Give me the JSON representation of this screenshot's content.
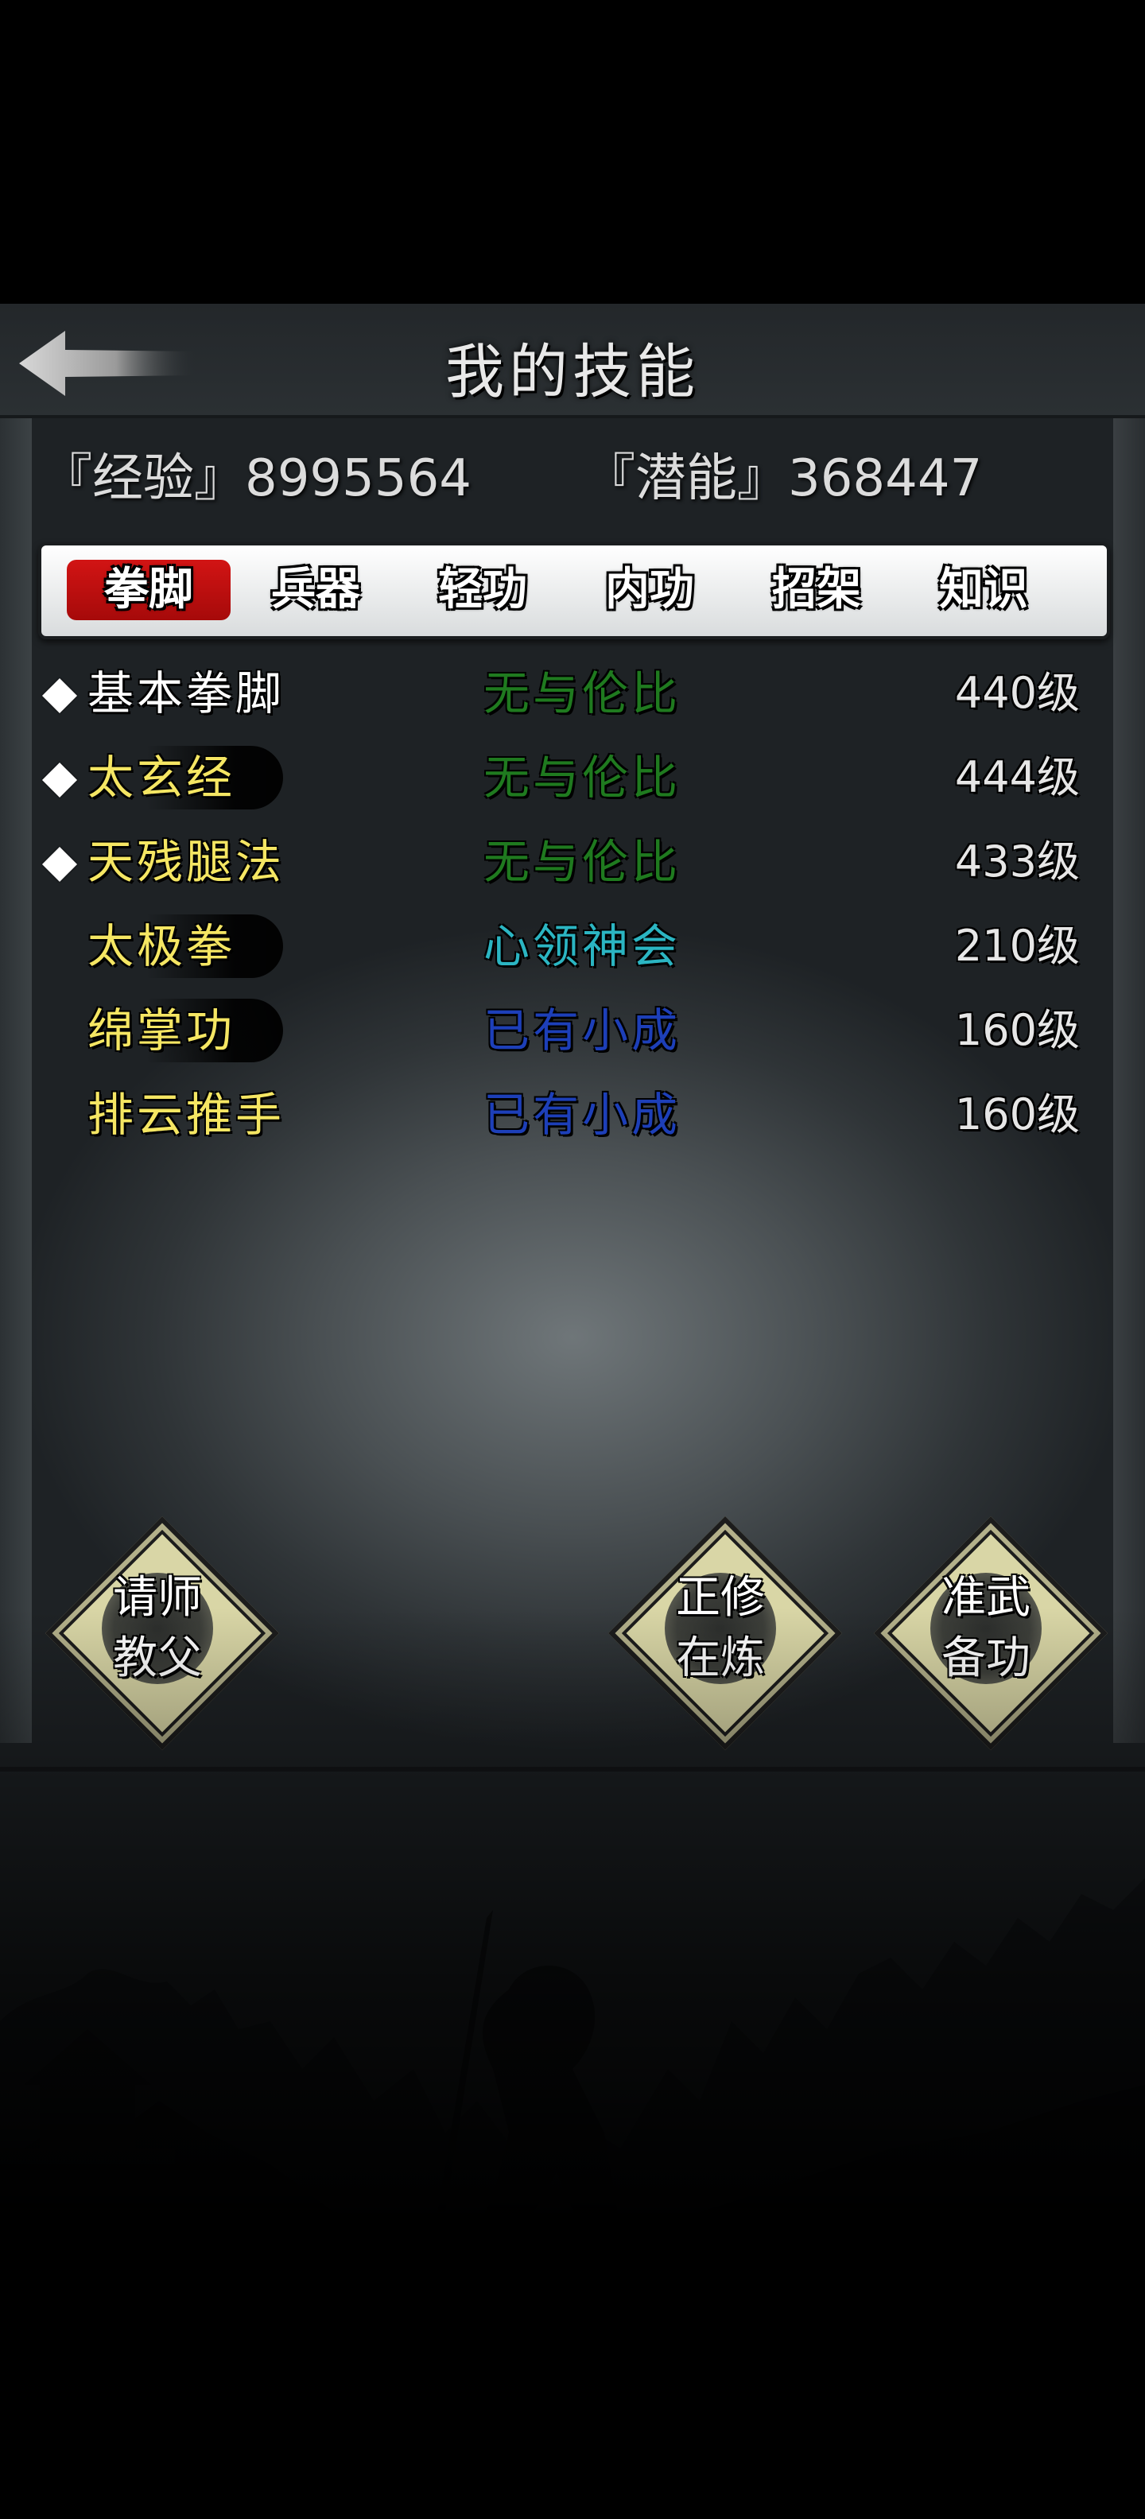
{
  "header": {
    "title": "我的技能",
    "back_icon": "back-arrow-icon"
  },
  "stats": {
    "experience": "『经验』8995564",
    "potential": "『潜能』368447"
  },
  "tabs": [
    {
      "label": "拳脚",
      "active": true
    },
    {
      "label": "兵器",
      "active": false
    },
    {
      "label": "轻功",
      "active": false
    },
    {
      "label": "内功",
      "active": false
    },
    {
      "label": "招架",
      "active": false
    },
    {
      "label": "知识",
      "active": false
    }
  ],
  "skills": [
    {
      "name": "基本拳脚",
      "rank": "无与伦比",
      "level": "440级",
      "marked": true,
      "name_color": "#ffffff",
      "rank_color": "#1f7a1f"
    },
    {
      "name": "太玄经",
      "rank": "无与伦比",
      "level": "444级",
      "marked": true,
      "name_color": "#f5e663",
      "rank_color": "#1f7a1f"
    },
    {
      "name": "天残腿法",
      "rank": "无与伦比",
      "level": "433级",
      "marked": true,
      "name_color": "#f5e663",
      "rank_color": "#1f7a1f"
    },
    {
      "name": "太极拳",
      "rank": "心领神会",
      "level": "210级",
      "marked": false,
      "name_color": "#f5e663",
      "rank_color": "#2bb5c2"
    },
    {
      "name": "绵掌功",
      "rank": "已有小成",
      "level": "160级",
      "marked": false,
      "name_color": "#f5e663",
      "rank_color": "#1d3fb8"
    },
    {
      "name": "排云推手",
      "rank": "已有小成",
      "level": "160级",
      "marked": false,
      "name_color": "#f5e663",
      "rank_color": "#1d3fb8"
    }
  ],
  "actions": {
    "master": {
      "line1": "请师",
      "line2": "教父"
    },
    "practice": {
      "line1": "正修",
      "line2": "在炼"
    },
    "prepare": {
      "line1": "准武",
      "line2": "备功"
    }
  },
  "colors": {
    "tab_active": "#c01010",
    "button_face": "#d9d6a6"
  }
}
